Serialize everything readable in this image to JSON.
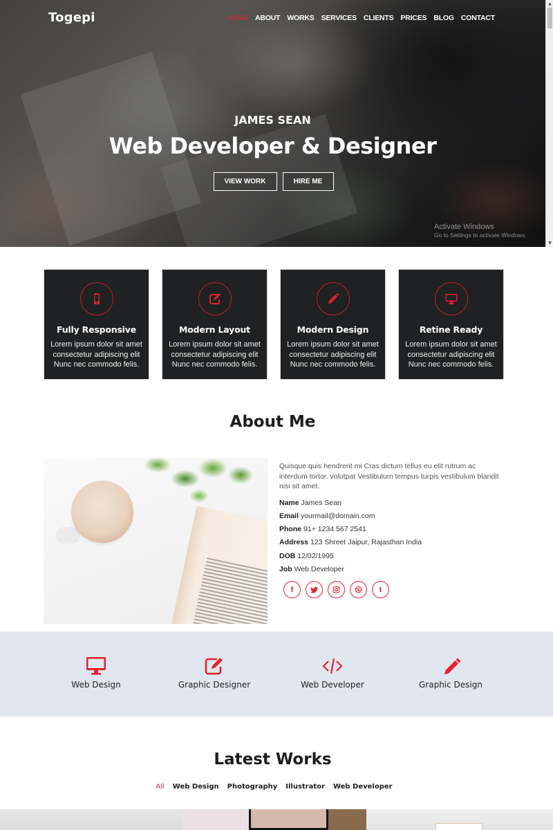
{
  "header": {
    "brand": "Togepi",
    "nav": [
      {
        "label": "HOME",
        "active": true
      },
      {
        "label": "ABOUT",
        "active": false
      },
      {
        "label": "WORKS",
        "active": false
      },
      {
        "label": "SERVICES",
        "active": false
      },
      {
        "label": "CLIENTS",
        "active": false
      },
      {
        "label": "PRICES",
        "active": false
      },
      {
        "label": "BLOG",
        "active": false
      },
      {
        "label": "CONTACT",
        "active": false
      }
    ]
  },
  "hero": {
    "subtitle": "JAMES SEAN",
    "title": "Web Developer & Designer",
    "view_work_label": "VIEW WORK",
    "hire_me_label": "HIRE ME"
  },
  "watermark": {
    "line1": "Activate Windows",
    "line2": "Go to Settings to activate Windows."
  },
  "features": [
    {
      "icon": "mobile-icon",
      "title": "Fully Responsive",
      "text": "Lorem ipsum dolor sit amet consectetur adipiscing elit Nunc nec commodo felis."
    },
    {
      "icon": "edit-icon",
      "title": "Modern Layout",
      "text": "Lorem ipsum dolor sit amet consectetur adipiscing elit Nunc nec commodo felis."
    },
    {
      "icon": "pencil-icon",
      "title": "Modern Design",
      "text": "Lorem ipsum dolor sit amet consectetur adipiscing elit Nunc nec commodo felis."
    },
    {
      "icon": "desktop-icon",
      "title": "Retine Ready",
      "text": "Lorem ipsum dolor sit amet consectetur adipiscing elit Nunc nec commodo felis."
    }
  ],
  "about": {
    "title": "About Me",
    "intro": "Quisque quis hendrerit mi Cras dictum tellus eu elit rutrum ac interdum tortor. volutpat Vestibulum tempus turpis vestibulum blandit nisi sit amet.",
    "info": [
      {
        "label": "Name",
        "value": "James Sean"
      },
      {
        "label": "Email",
        "value": "yourmail@domain.com"
      },
      {
        "label": "Phone",
        "value": "91+ 1234 567 2541"
      },
      {
        "label": "Address",
        "value": "123 Shreet Jaipur, Rajasthan India"
      },
      {
        "label": "DOB",
        "value": "12/02/1995"
      },
      {
        "label": "Job",
        "value": "Web Developer"
      }
    ],
    "socials": [
      {
        "name": "facebook-icon",
        "glyph": "f"
      },
      {
        "name": "twitter-icon",
        "glyph": "🐦"
      },
      {
        "name": "instagram-icon",
        "glyph": "◎"
      },
      {
        "name": "dribbble-icon",
        "glyph": "⊛"
      },
      {
        "name": "tumblr-icon",
        "glyph": "t"
      }
    ]
  },
  "services": [
    {
      "icon": "desktop-icon",
      "label": "Web Design"
    },
    {
      "icon": "edit-icon",
      "label": "Graphic Designer"
    },
    {
      "icon": "code-icon",
      "label": "Web Developer"
    },
    {
      "icon": "pencil-icon",
      "label": "Graphic Design"
    }
  ],
  "works": {
    "title": "Latest Works",
    "filters": [
      {
        "label": "All",
        "active": true
      },
      {
        "label": "Web Design",
        "active": false
      },
      {
        "label": "Photography",
        "active": false
      },
      {
        "label": "Illustrator",
        "active": false
      },
      {
        "label": "Web Developer",
        "active": false
      }
    ]
  },
  "colors": {
    "accent": "#e8202f",
    "feature_bg": "#1f2122",
    "services_bg": "#e1e7ef"
  }
}
